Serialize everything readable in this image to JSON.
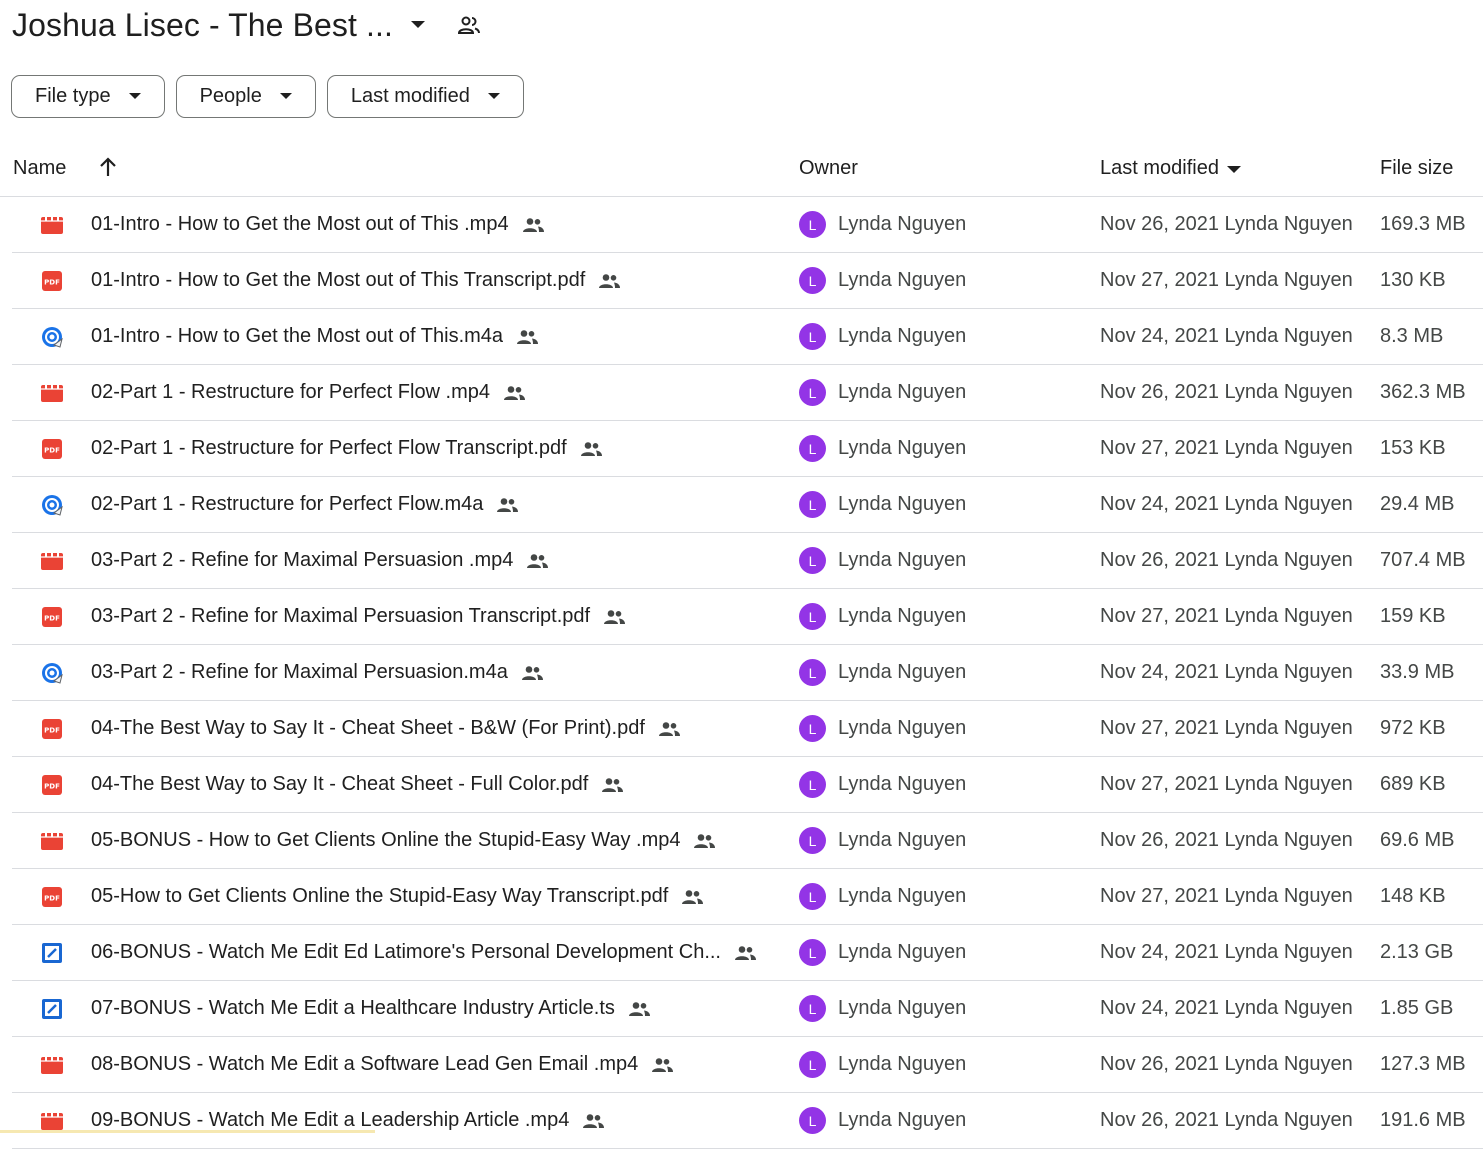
{
  "header": {
    "title": "Joshua Lisec - The Best ..."
  },
  "filters": {
    "file_type": "File type",
    "people": "People",
    "last_modified": "Last modified"
  },
  "columns": {
    "name": "Name",
    "owner": "Owner",
    "last_modified": "Last modified",
    "file_size": "File size"
  },
  "colors": {
    "avatar": "#9334e6",
    "video": "#ea4335",
    "pdf": "#ea4335",
    "audio": "#1a73e8"
  },
  "files": [
    {
      "name": "01-Intro - How to Get the Most out of This .mp4",
      "icon": "video-icon",
      "owner_initial": "L",
      "owner": "Lynda Nguyen",
      "modified": "Nov 26, 2021 Lynda Nguyen",
      "size": "169.3 MB"
    },
    {
      "name": "01-Intro - How to Get the Most out of This Transcript.pdf",
      "icon": "pdf-icon",
      "owner_initial": "L",
      "owner": "Lynda Nguyen",
      "modified": "Nov 27, 2021 Lynda Nguyen",
      "size": "130 KB"
    },
    {
      "name": "01-Intro - How to Get the Most out of This.m4a",
      "icon": "audio-icon",
      "owner_initial": "L",
      "owner": "Lynda Nguyen",
      "modified": "Nov 24, 2021 Lynda Nguyen",
      "size": "8.3 MB"
    },
    {
      "name": "02-Part 1 - Restructure for Perfect Flow .mp4",
      "icon": "video-icon",
      "owner_initial": "L",
      "owner": "Lynda Nguyen",
      "modified": "Nov 26, 2021 Lynda Nguyen",
      "size": "362.3 MB"
    },
    {
      "name": "02-Part 1 - Restructure for Perfect Flow Transcript.pdf",
      "icon": "pdf-icon",
      "owner_initial": "L",
      "owner": "Lynda Nguyen",
      "modified": "Nov 27, 2021 Lynda Nguyen",
      "size": "153 KB"
    },
    {
      "name": "02-Part 1 - Restructure for Perfect Flow.m4a",
      "icon": "audio-icon",
      "owner_initial": "L",
      "owner": "Lynda Nguyen",
      "modified": "Nov 24, 2021 Lynda Nguyen",
      "size": "29.4 MB"
    },
    {
      "name": "03-Part 2 - Refine for Maximal Persuasion .mp4",
      "icon": "video-icon",
      "owner_initial": "L",
      "owner": "Lynda Nguyen",
      "modified": "Nov 26, 2021 Lynda Nguyen",
      "size": "707.4 MB"
    },
    {
      "name": "03-Part 2 - Refine for Maximal Persuasion Transcript.pdf",
      "icon": "pdf-icon",
      "owner_initial": "L",
      "owner": "Lynda Nguyen",
      "modified": "Nov 27, 2021 Lynda Nguyen",
      "size": "159 KB"
    },
    {
      "name": "03-Part 2 - Refine for Maximal Persuasion.m4a",
      "icon": "audio-icon",
      "owner_initial": "L",
      "owner": "Lynda Nguyen",
      "modified": "Nov 24, 2021 Lynda Nguyen",
      "size": "33.9 MB"
    },
    {
      "name": "04-The Best Way to Say It - Cheat Sheet - B&W (For Print).pdf",
      "icon": "pdf-icon",
      "owner_initial": "L",
      "owner": "Lynda Nguyen",
      "modified": "Nov 27, 2021 Lynda Nguyen",
      "size": "972 KB"
    },
    {
      "name": "04-The Best Way to Say It - Cheat Sheet - Full Color.pdf",
      "icon": "pdf-icon",
      "owner_initial": "L",
      "owner": "Lynda Nguyen",
      "modified": "Nov 27, 2021 Lynda Nguyen",
      "size": "689 KB"
    },
    {
      "name": "05-BONUS - How to Get Clients Online the Stupid-Easy Way .mp4",
      "icon": "video-icon",
      "owner_initial": "L",
      "owner": "Lynda Nguyen",
      "modified": "Nov 26, 2021 Lynda Nguyen",
      "size": "69.6 MB"
    },
    {
      "name": "05-How to Get Clients Online the Stupid-Easy Way Transcript.pdf",
      "icon": "pdf-icon",
      "owner_initial": "L",
      "owner": "Lynda Nguyen",
      "modified": "Nov 27, 2021 Lynda Nguyen",
      "size": "148 KB"
    },
    {
      "name": "06-BONUS - Watch Me Edit Ed Latimore's Personal Development Ch...",
      "icon": "ts-file-icon",
      "owner_initial": "L",
      "owner": "Lynda Nguyen",
      "modified": "Nov 24, 2021 Lynda Nguyen",
      "size": "2.13 GB"
    },
    {
      "name": "07-BONUS - Watch Me Edit a Healthcare Industry Article.ts",
      "icon": "ts-file-icon",
      "owner_initial": "L",
      "owner": "Lynda Nguyen",
      "modified": "Nov 24, 2021 Lynda Nguyen",
      "size": "1.85 GB"
    },
    {
      "name": "08-BONUS - Watch Me Edit a Software Lead Gen Email .mp4",
      "icon": "video-icon",
      "owner_initial": "L",
      "owner": "Lynda Nguyen",
      "modified": "Nov 26, 2021 Lynda Nguyen",
      "size": "127.3 MB"
    },
    {
      "name": "09-BONUS - Watch Me Edit a Leadership Article .mp4",
      "icon": "video-icon",
      "owner_initial": "L",
      "owner": "Lynda Nguyen",
      "modified": "Nov 26, 2021 Lynda Nguyen",
      "size": "191.6 MB"
    }
  ]
}
